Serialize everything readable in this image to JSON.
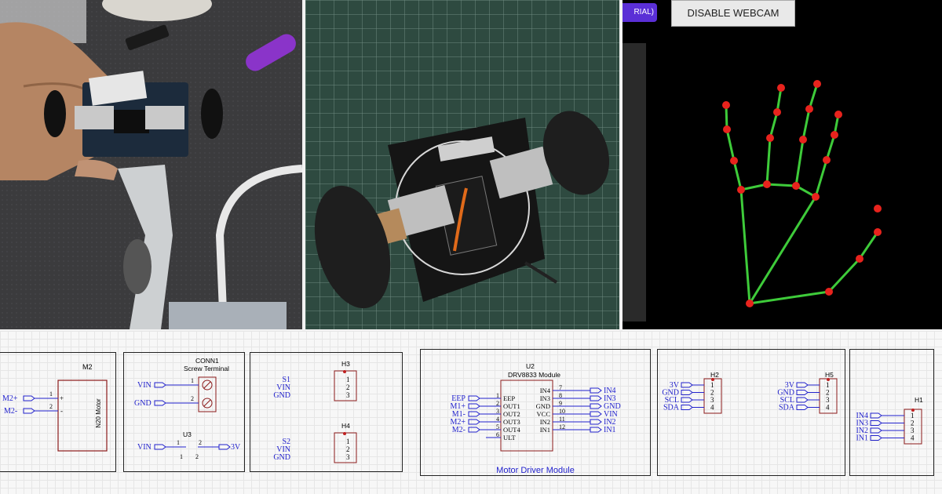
{
  "webcam": {
    "left_button_label": "RIAL)",
    "disable_button_label": "DISABLE WEBCAM",
    "colors": {
      "joint": "#e8231d",
      "bone": "#3ecb3a",
      "left_button": "#5a2fd6"
    }
  },
  "schematic": {
    "m2": {
      "ref": "M2",
      "value": "N20 Motor",
      "pins": [
        "M2+",
        "M2-"
      ],
      "pin_numbers": [
        "1",
        "2"
      ],
      "polarity": [
        "+",
        "-"
      ]
    },
    "conn1": {
      "ref": "CONN1",
      "value": "Screw Terminal",
      "pins": [
        "VIN",
        "GND"
      ],
      "pin_numbers": [
        "1",
        "2"
      ]
    },
    "u3": {
      "ref": "U3",
      "pin_in": "VIN",
      "pin_out": "3V",
      "pin_numbers": [
        "1",
        "2",
        "1",
        "2"
      ]
    },
    "h3": {
      "ref": "H3",
      "pins": [
        "S1",
        "VIN",
        "GND"
      ],
      "pin_numbers": [
        "1",
        "2",
        "3"
      ]
    },
    "h4": {
      "ref": "H4",
      "pins": [
        "S2",
        "VIN",
        "GND"
      ],
      "pin_numbers": [
        "1",
        "2",
        "3"
      ]
    },
    "u2": {
      "ref": "U2",
      "value": "DRV8833 Module",
      "title": "Motor Driver Module",
      "left_nets": [
        "EEP",
        "M1+",
        "M1-",
        "M2+",
        "M2-"
      ],
      "left_pins": [
        "EEP",
        "OUT1",
        "OUT2",
        "OUT3",
        "OUT4",
        "ULT"
      ],
      "left_numbers": [
        "1",
        "2",
        "3",
        "4",
        "5",
        "6"
      ],
      "right_pins": [
        "IN4",
        "IN3",
        "GND",
        "VCC",
        "IN2",
        "IN1"
      ],
      "right_numbers": [
        "7",
        "8",
        "9",
        "10",
        "11",
        "12"
      ],
      "right_nets": [
        "IN4",
        "IN3",
        "GND",
        "VIN",
        "IN2",
        "IN1"
      ]
    },
    "h2": {
      "ref": "H2",
      "pins": [
        "3V",
        "GND",
        "SCL",
        "SDA"
      ],
      "pin_numbers": [
        "1",
        "2",
        "3",
        "4"
      ]
    },
    "h5": {
      "ref": "H5",
      "pins": [
        "3V",
        "GND",
        "SCL",
        "SDA"
      ],
      "pin_numbers": [
        "1",
        "2",
        "3",
        "4"
      ]
    },
    "h1": {
      "ref": "H1",
      "pins": [
        "IN4",
        "IN3",
        "IN2",
        "IN1"
      ],
      "pin_numbers": [
        "1",
        "2",
        "3",
        "4"
      ]
    }
  }
}
